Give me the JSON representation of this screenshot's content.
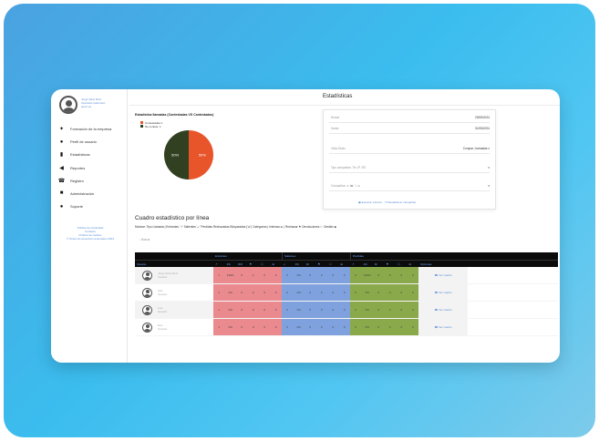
{
  "sidebar": {
    "user_lines": [
      "Jorge Sanz Ruiz",
      "Operador telefonico",
      "jsanz.es"
    ],
    "items": [
      {
        "icon": "megaphone-icon",
        "glyph": "✦",
        "label": "Formación de la empresa"
      },
      {
        "icon": "user-icon",
        "glyph": "●",
        "label": "Perfil de usuario"
      },
      {
        "icon": "bar-chart-icon",
        "glyph": "▮",
        "label": "Estadísticas"
      },
      {
        "icon": "speaker-icon",
        "glyph": "◀",
        "label": "Reportes"
      },
      {
        "icon": "phone-icon",
        "glyph": "☎",
        "label": "Registro"
      },
      {
        "icon": "lock-icon",
        "glyph": "■",
        "label": "Administración"
      },
      {
        "icon": "info-icon",
        "glyph": "●",
        "label": "Soporte"
      }
    ],
    "footer_lines": [
      "Política de privacidad",
      "Contacto",
      "Política de cookies",
      "© Todos los derechos reservados 2024"
    ]
  },
  "header": {
    "title": "Estadísticas"
  },
  "pie_chart": {
    "title": "Estadística llamadas (Contestadas VS Contestadas)",
    "legend": [
      {
        "label": "Contestadas 1",
        "color": "#e8552a"
      },
      {
        "label": "No contest. 1",
        "color": "#324022"
      }
    ]
  },
  "chart_data": {
    "type": "pie",
    "labels": [
      "Contestadas 1",
      "No contest. 1"
    ],
    "values": [
      50,
      50
    ],
    "slice_labels": [
      "50%",
      "50%"
    ],
    "colors": [
      "#e8552a",
      "#324022"
    ]
  },
  "filters": {
    "rows": [
      {
        "label": "Desde",
        "value": "29/05/2024"
      },
      {
        "label": "Hasta",
        "value": "31/05/2024"
      },
      {
        "label": "Vista Modo",
        "value": "Compar. Llamadas ▾"
      },
      {
        "label": "Tipo campañas: Tel. IP, RS",
        "value": "▾"
      },
      {
        "label": "Campañas: ✉ ☎ ☐ ⊞",
        "value": "▾"
      }
    ],
    "buttons": [
      "▣ Exportar a Excel",
      "⟲ Restablecer campañas"
    ]
  },
  "table_section": {
    "title": "Cuadro estadístico por línea",
    "subtitle": "Mostrar: Tipo Llamada | Entrantes '↗' Salientes '↙' Perdidas Rechazadas Bloqueadas ('⊘') Categorías | Internas ⊞ | Rechazar ⚑ Devoluciones ⚐ Gestión ■",
    "search_placeholder": "Buscar",
    "group_headers": [
      "",
      "Entrantes",
      "Salientes",
      "Perdidas",
      ""
    ],
    "sub_headers": [
      "Usuario",
      "↗",
      "1%",
      "⊘⊘",
      "⚑",
      "☐",
      "⊞",
      "↙",
      "1%",
      "⊠",
      "⚑",
      "☐",
      "⊞",
      "↗",
      "1%",
      "⊠",
      "⚑",
      "☐",
      "⊞",
      "Opciones"
    ],
    "rows": [
      {
        "name": "Jorge Sanz Ruiz",
        "sub": "Usuario",
        "red": [
          "1",
          "100%",
          "0",
          "1",
          "0",
          "0"
        ],
        "blue": [
          "0",
          "0%",
          "0",
          "0",
          "0",
          "0"
        ],
        "green": [
          "0",
          "100%",
          "0",
          "0",
          "0",
          "0"
        ],
        "action": "☎ Ver cuadro"
      },
      {
        "name": "Ana",
        "sub": "Usuario",
        "red": [
          "1",
          "0%",
          "0",
          "0",
          "0",
          "0"
        ],
        "blue": [
          "0",
          "0%",
          "0",
          "0",
          "0",
          "0"
        ],
        "green": [
          "0",
          "0%",
          "0",
          "0",
          "0",
          "0"
        ],
        "action": "☎ Ver cuadro"
      },
      {
        "name": "Luis",
        "sub": "Usuario",
        "red": [
          "1",
          "0%",
          "0",
          "0",
          "0",
          "0"
        ],
        "blue": [
          "0",
          "0%",
          "0",
          "0",
          "0",
          "0"
        ],
        "green": [
          "0",
          "0%",
          "0",
          "0",
          "0",
          "0"
        ],
        "action": "☎ Ver cuadro"
      },
      {
        "name": "Eva",
        "sub": "Usuario",
        "red": [
          "1",
          "0%",
          "0",
          "0",
          "0",
          "0"
        ],
        "blue": [
          "0",
          "0%",
          "0",
          "0",
          "0",
          "0"
        ],
        "green": [
          "0",
          "0%",
          "0",
          "0",
          "0",
          "0"
        ],
        "action": "☎ Ver cuadro"
      }
    ]
  }
}
